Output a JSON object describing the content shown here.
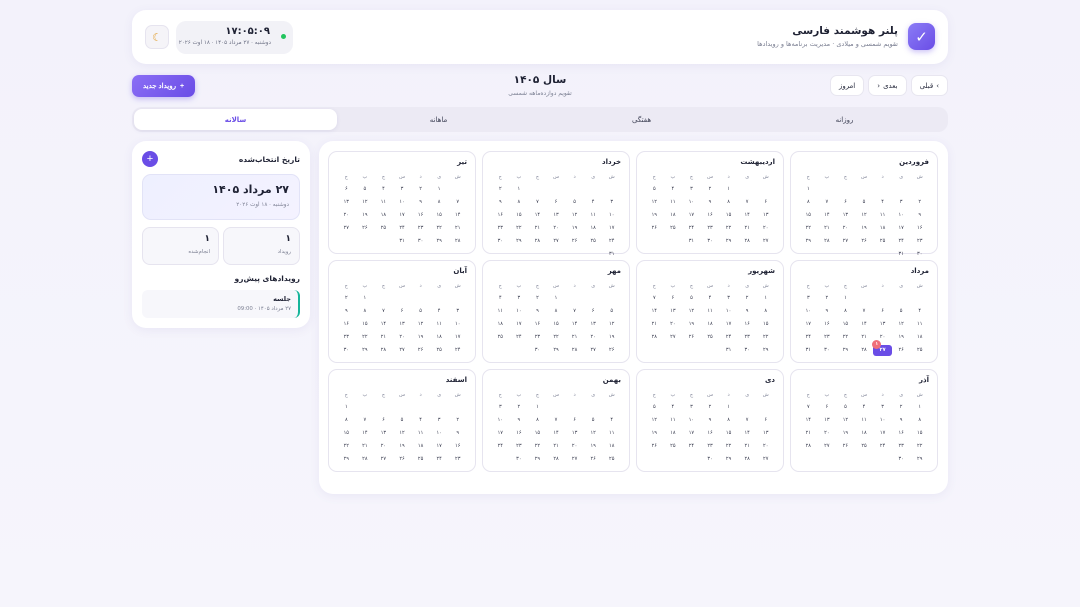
{
  "header": {
    "app_title": "پلنر هوشمند فارسی",
    "app_subtitle": "تقویم شمسی و میلادی · مدیریت برنامه‌ها و رویدادها",
    "logo_icon": "checkmark-icon",
    "clock_time": "۱۷:۰۵:۰۹",
    "clock_date": "دوشنبه · ۲۷ مرداد ۱۴۰۵ · ۱۸ اوت ۲۰۲۶",
    "theme_icon": "moon-icon",
    "status_color": "#22c55e"
  },
  "toolbar": {
    "prev_label": "قبلی",
    "next_label": "بعدی",
    "today_label": "امروز",
    "period_title": "سال ۱۴۰۵",
    "period_subtitle": "تقویم دوازده‌ماهه شمسی",
    "new_event_label": "رویداد جدید"
  },
  "tabs": [
    {
      "label": "روزانه",
      "active": false
    },
    {
      "label": "هفتگی",
      "active": false
    },
    {
      "label": "ماهانه",
      "active": false
    },
    {
      "label": "سالانه",
      "active": true
    }
  ],
  "weekdays": [
    "ش",
    "ی",
    "د",
    "س",
    "چ",
    "پ",
    "ج"
  ],
  "accent_color": "#6a4de6",
  "today": {
    "month_index": 4,
    "day": 27,
    "event_count": "۱"
  },
  "months": [
    {
      "name": "فروردین",
      "offset": 6,
      "days": 31
    },
    {
      "name": "اردیبهشت",
      "offset": 2,
      "days": 31
    },
    {
      "name": "خرداد",
      "offset": 5,
      "days": 31
    },
    {
      "name": "تیر",
      "offset": 1,
      "days": 31
    },
    {
      "name": "مرداد",
      "offset": 4,
      "days": 31
    },
    {
      "name": "شهریور",
      "offset": 0,
      "days": 31
    },
    {
      "name": "مهر",
      "offset": 3,
      "days": 30
    },
    {
      "name": "آبان",
      "offset": 5,
      "days": 30
    },
    {
      "name": "آذر",
      "offset": 0,
      "days": 30
    },
    {
      "name": "دی",
      "offset": 2,
      "days": 30
    },
    {
      "name": "بهمن",
      "offset": 4,
      "days": 30
    },
    {
      "name": "اسفند",
      "offset": 6,
      "days": 29
    }
  ],
  "sidebar": {
    "title": "تاریخ انتخاب‌شده",
    "selected_date": "۲۷ مرداد ۱۴۰۵",
    "selected_sub": "دوشنبه · ۱۸ اوت ۲۰۲۶",
    "stats": [
      {
        "value": "۱",
        "label": "رویداد"
      },
      {
        "value": "۱",
        "label": "انجام‌شده"
      }
    ],
    "upcoming_title": "رویدادهای پیش‌رو",
    "events": [
      {
        "title": "جلسه",
        "time": "۲۷ مرداد ۱۴۰۵ · 09:00",
        "color": "#16b59a"
      }
    ]
  }
}
